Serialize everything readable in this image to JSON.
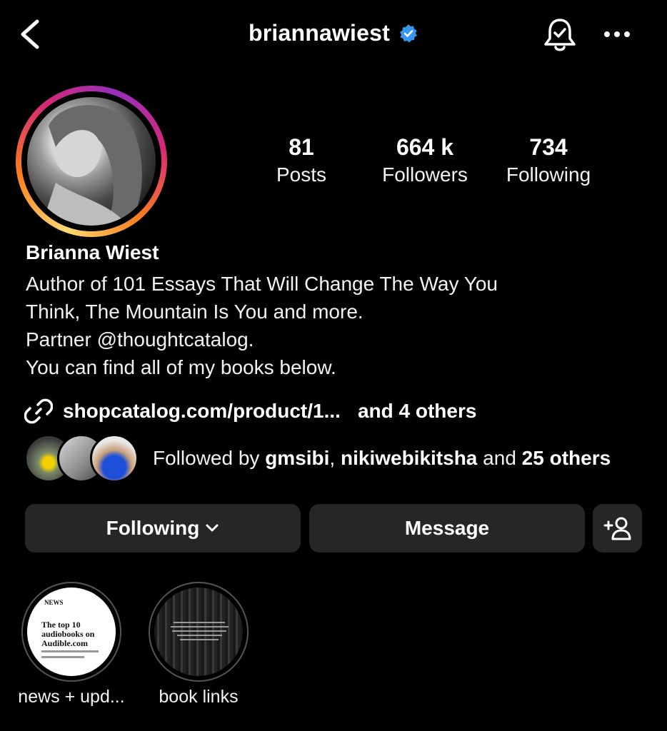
{
  "header": {
    "username": "briannawiest",
    "verified": true
  },
  "profile": {
    "stats": [
      {
        "value": "81",
        "label": "Posts"
      },
      {
        "value": "664 k",
        "label": "Followers"
      },
      {
        "value": "734",
        "label": "Following"
      }
    ],
    "name": "Brianna Wiest",
    "bio": [
      "Author of 101 Essays That Will Change The Way You",
      "Think, The Mountain Is You and more.",
      "Partner @thoughtcatalog.",
      "You can find all of my books below."
    ],
    "link": {
      "text": "shopcatalog.com/product/1...",
      "others": "and 4 others"
    },
    "followed_by": {
      "prefix": "Followed by ",
      "user1": "gmsibi",
      "sep": ", ",
      "user2": "nikiwebikitsha",
      "and": " and ",
      "others": "25 others"
    }
  },
  "actions": {
    "following": "Following",
    "message": "Message"
  },
  "highlights": [
    {
      "label": "news + upd...",
      "cover_text": {
        "brand": "NEWS",
        "headline": "The top 10 audiobooks on Audible.com"
      }
    },
    {
      "label": "book links"
    }
  ],
  "colors": {
    "verified": "#3897f0",
    "button_bg": "#262626",
    "background": "#000000"
  }
}
